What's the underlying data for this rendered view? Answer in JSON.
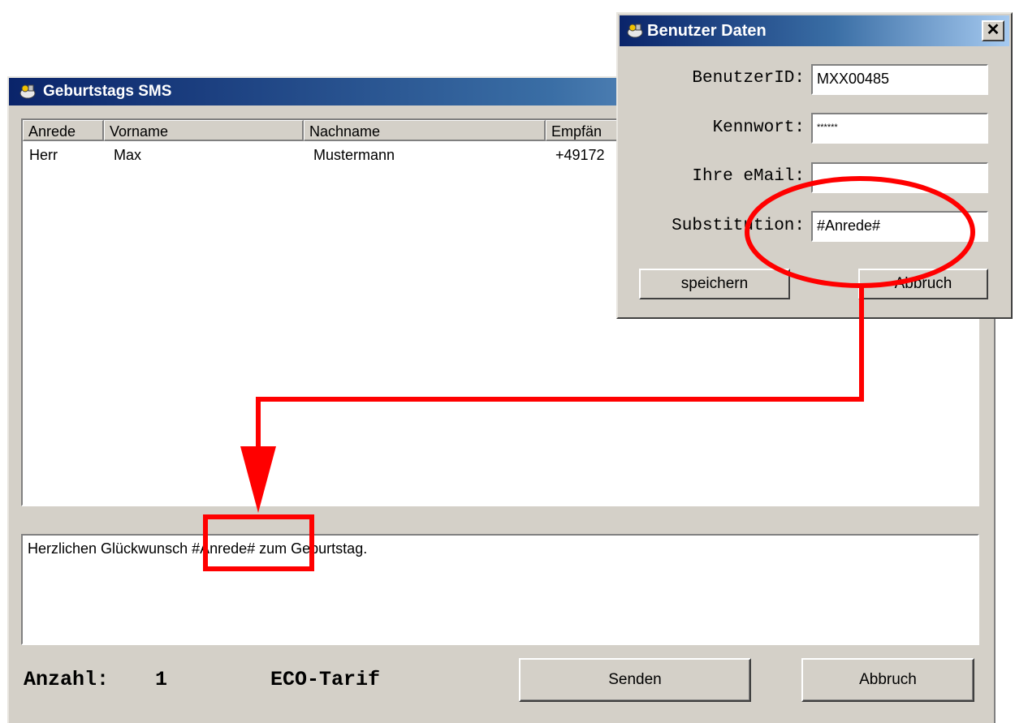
{
  "main_window": {
    "title": "Geburtstags SMS",
    "columns": [
      "Anrede",
      "Vorname",
      "Nachname",
      "Empfän"
    ],
    "rows": [
      [
        "Herr",
        "Max",
        "Mustermann",
        "+49172"
      ]
    ],
    "message": "Herzlichen Glückwunsch #Anrede# zum Geburtstag.",
    "count_label": "Anzahl:",
    "count_value": "1",
    "tariff_label": "ECO-Tarif",
    "send_label": "Senden",
    "cancel_label": "Abbruch"
  },
  "dialog": {
    "title": "Benutzer Daten",
    "close_glyph": "✕",
    "fields": {
      "user_id_label": "BenutzerID:",
      "user_id_value": "MXX00485",
      "password_label": "Kennwort:",
      "password_value": "******",
      "email_label": "Ihre eMail:",
      "email_value": "",
      "substitution_label": "Substitution:",
      "substitution_value": "#Anrede#"
    },
    "save_label": "speichern",
    "cancel_label": "Abbruch"
  },
  "colors": {
    "titlebar_start": "#0a246a",
    "titlebar_end": "#a6caf0",
    "window_bg": "#d4d0c8",
    "annotation": "#ff0000"
  },
  "icons": {
    "app": "app-icon",
    "close": "close-icon"
  }
}
